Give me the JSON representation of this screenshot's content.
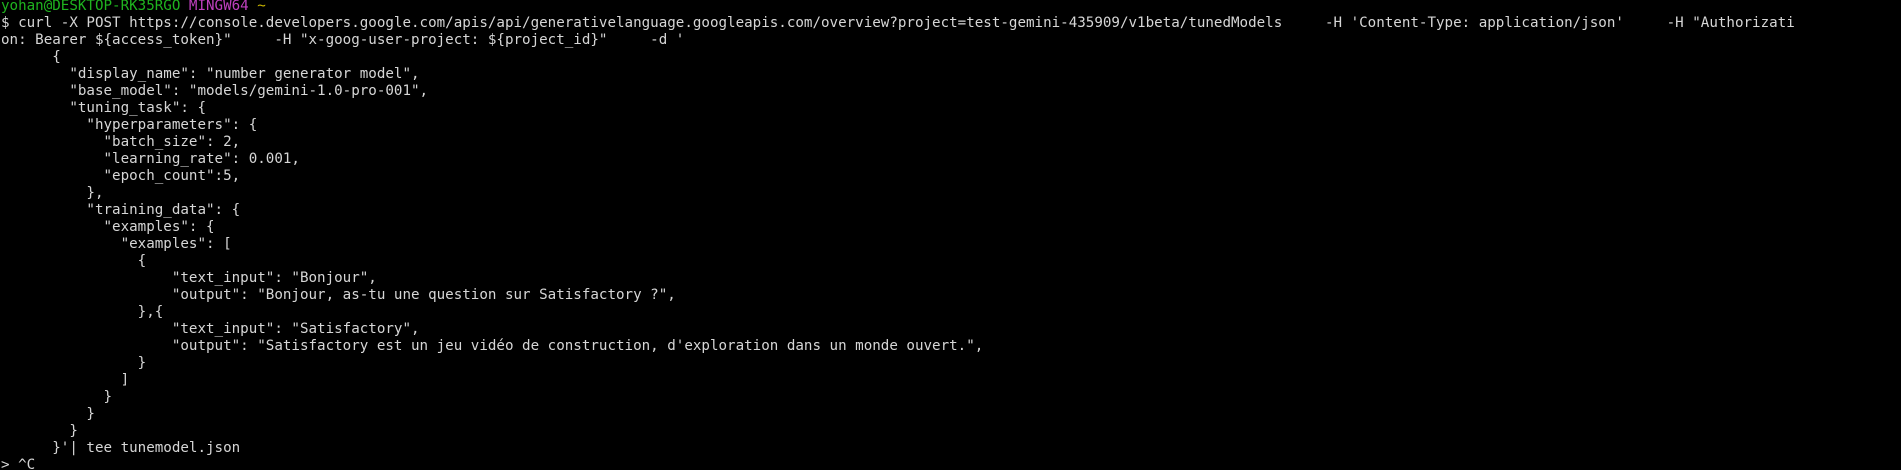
{
  "prompt": {
    "user_host": "yohan@DESKTOP-RK35RGO",
    "system": "MINGW64",
    "cwd": "~",
    "symbol": "$"
  },
  "command_lines": [
    " curl -X POST https://console.developers.google.com/apis/api/generativelanguage.googleapis.com/overview?project=test-gemini-435909/v1beta/tunedModels     -H 'Content-Type: application/json'     -H \"Authorizati",
    "on: Bearer ${access_token}\"     -H \"x-goog-user-project: ${project_id}\"     -d '",
    "      {",
    "        \"display_name\": \"number generator model\",",
    "        \"base_model\": \"models/gemini-1.0-pro-001\",",
    "        \"tuning_task\": {",
    "          \"hyperparameters\": {",
    "            \"batch_size\": 2,",
    "            \"learning_rate\": 0.001,",
    "            \"epoch_count\":5,",
    "          },",
    "          \"training_data\": {",
    "            \"examples\": {",
    "              \"examples\": [",
    "                {",
    "                    \"text_input\": \"Bonjour\",",
    "                    \"output\": \"Bonjour, as-tu une question sur Satisfactory ?\",",
    "                },{",
    "                    \"text_input\": \"Satisfactory\",",
    "                    \"output\": \"Satisfactory est un jeu vidéo de construction, d'exploration dans un monde ouvert.\",",
    "                }",
    "              ]",
    "            }",
    "          }",
    "        }",
    "      }'| tee tunemodel.json",
    "> ^C"
  ],
  "colors": {
    "background": "#000000",
    "text": "#d6d6d6",
    "user_host": "#1fb41f",
    "system": "#bf40bf",
    "cwd": "#c8b400"
  }
}
